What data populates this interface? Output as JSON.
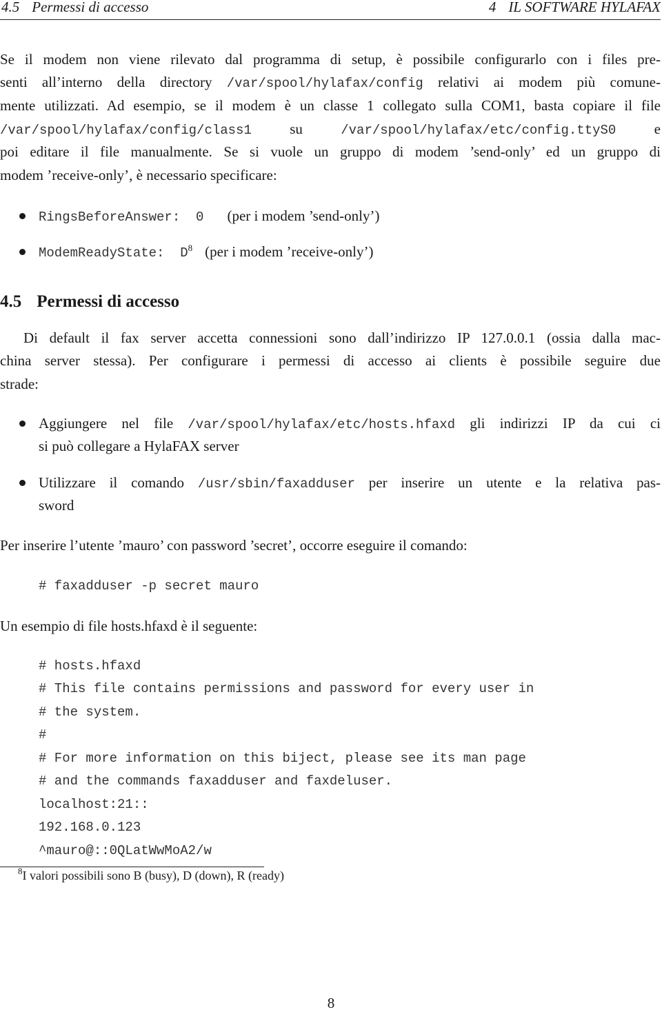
{
  "header": {
    "section_number": "4.5",
    "section_title": "Permessi di accesso",
    "chapter_number": "4",
    "chapter_title": "IL SOFTWARE HYLAFAX"
  },
  "para1": {
    "l1": "Se il modem non viene rilevato dal programma di setup, è possibile configurarlo con i files pre-",
    "l2_a": "senti all’interno della directory ",
    "l2_code": "/var/spool/hylafax/config",
    "l2_b": " relativi ai modem più comune-",
    "l3": "mente utilizzati. Ad esempio, se il modem è un classe 1 collegato sulla COM1, basta copiare il file",
    "l4_code1": "/var/spool/hylafax/config/class1",
    "l4_mid": " su ",
    "l4_code2": "/var/spool/hylafax/etc/config.ttyS0",
    "l4_end": " e",
    "l5": "poi editare il file manualmente.  Se si vuole un gruppo di modem ’send-only’ ed un gruppo di",
    "l6": "modem ’receive-only’, è necessario specificare:"
  },
  "modem_bullets": [
    {
      "code": "RingsBeforeAnswer:  0",
      "footnote": "",
      "text": "(per i modem ’send-only’)"
    },
    {
      "code": "ModemReadyState:  D",
      "footnote": "8",
      "text": "(per i modem ’receive-only’)"
    }
  ],
  "section": {
    "number": "4.5",
    "title": "Permessi di accesso"
  },
  "para2": {
    "l1": "Di default il fax server accetta connessioni sono dall’indirizzo IP 127.0.0.1 (ossia dalla mac-",
    "l2": "china server stessa).  Per configurare i permessi di accesso ai clients è possibile seguire due",
    "l3": "strade:"
  },
  "access_bullets": [
    {
      "l1_a": "Aggiungere nel file ",
      "l1_code": "/var/spool/hylafax/etc/hosts.hfaxd",
      "l1_b": " gli indirizzi IP da cui ci",
      "l2": "si può collegare a HylaFAX server"
    },
    {
      "l1_a": "Utilizzare il comando ",
      "l1_code": "/usr/sbin/faxadduser",
      "l1_b": " per inserire un utente e la relativa pas-",
      "l2": "sword"
    }
  ],
  "para3": "Per inserire l’utente ’mauro’ con password ’secret’, occorre eseguire il comando:",
  "command": "# faxadduser -p secret mauro",
  "para4": "Un esempio di file hosts.hfaxd è il seguente:",
  "hosts_file": [
    "# hosts.hfaxd",
    "# This file contains permissions and password for every user in",
    "# the system.",
    "#",
    "# For more information on this biject, please see its man page",
    "# and the commands faxadduser and faxdeluser.",
    "localhost:21::",
    "192.168.0.123",
    "^mauro@::0QLatWwMoA2/w"
  ],
  "footnote": {
    "mark": "8",
    "text": "I valori possibili sono B (busy), D (down), R (ready)"
  },
  "page_number": "8"
}
